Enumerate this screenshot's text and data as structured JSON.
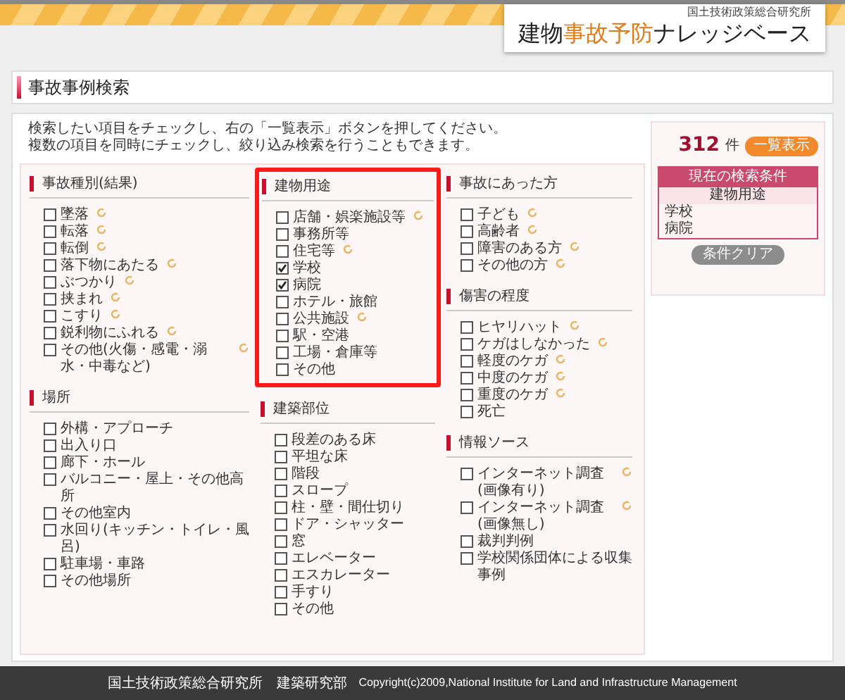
{
  "header": {
    "org": "国土技術政策総合研究所",
    "title_parts": [
      {
        "text": "建物",
        "accent": false
      },
      {
        "text": "事故予防",
        "accent": true
      },
      {
        "text": "ナレッジベース",
        "accent": false
      }
    ]
  },
  "page_title": "事故事例検索",
  "intro": [
    "検索したい項目をチェックし、右の「一覧表示」ボタンを押してください。",
    "複数の項目を同時にチェックし、絞り込み検索を行うこともできます。"
  ],
  "columns": [
    [
      {
        "heading": "事故種別(結果)",
        "highlighted": false,
        "items": [
          {
            "label": "墜落",
            "checked": false,
            "note": true
          },
          {
            "label": "転落",
            "checked": false,
            "note": true
          },
          {
            "label": "転倒",
            "checked": false,
            "note": true
          },
          {
            "label": "落下物にあたる",
            "checked": false,
            "note": true
          },
          {
            "label": "ぶつかり",
            "checked": false,
            "note": true
          },
          {
            "label": "挟まれ",
            "checked": false,
            "note": true
          },
          {
            "label": "こすり",
            "checked": false,
            "note": true
          },
          {
            "label": "鋭利物にふれる",
            "checked": false,
            "note": true
          },
          {
            "label": "その他(火傷・感電・溺水・中毒など)",
            "checked": false,
            "note": true
          }
        ]
      },
      {
        "heading": "場所",
        "highlighted": false,
        "items": [
          {
            "label": "外構・アプローチ",
            "checked": false,
            "note": false
          },
          {
            "label": "出入り口",
            "checked": false,
            "note": false
          },
          {
            "label": "廊下・ホール",
            "checked": false,
            "note": false
          },
          {
            "label": "バルコニー・屋上・その他高所",
            "checked": false,
            "note": false
          },
          {
            "label": "その他室内",
            "checked": false,
            "note": false
          },
          {
            "label": "水回り(キッチン・トイレ・風呂)",
            "checked": false,
            "note": false
          },
          {
            "label": "駐車場・車路",
            "checked": false,
            "note": false
          },
          {
            "label": "その他場所",
            "checked": false,
            "note": false
          }
        ]
      }
    ],
    [
      {
        "heading": "建物用途",
        "highlighted": true,
        "items": [
          {
            "label": "店舗・娯楽施設等",
            "checked": false,
            "note": true
          },
          {
            "label": "事務所等",
            "checked": false,
            "note": false
          },
          {
            "label": "住宅等",
            "checked": false,
            "note": true
          },
          {
            "label": "学校",
            "checked": true,
            "note": false
          },
          {
            "label": "病院",
            "checked": true,
            "note": false
          },
          {
            "label": "ホテル・旅館",
            "checked": false,
            "note": false
          },
          {
            "label": "公共施設",
            "checked": false,
            "note": true
          },
          {
            "label": "駅・空港",
            "checked": false,
            "note": false
          },
          {
            "label": "工場・倉庫等",
            "checked": false,
            "note": false
          },
          {
            "label": "その他",
            "checked": false,
            "note": false
          }
        ]
      },
      {
        "heading": "建築部位",
        "highlighted": false,
        "items": [
          {
            "label": "段差のある床",
            "checked": false,
            "note": false
          },
          {
            "label": "平坦な床",
            "checked": false,
            "note": false
          },
          {
            "label": "階段",
            "checked": false,
            "note": false
          },
          {
            "label": "スロープ",
            "checked": false,
            "note": false
          },
          {
            "label": "柱・壁・間仕切り",
            "checked": false,
            "note": false
          },
          {
            "label": "ドア・シャッター",
            "checked": false,
            "note": false
          },
          {
            "label": "窓",
            "checked": false,
            "note": false
          },
          {
            "label": "エレベーター",
            "checked": false,
            "note": false
          },
          {
            "label": "エスカレーター",
            "checked": false,
            "note": false
          },
          {
            "label": "手すり",
            "checked": false,
            "note": false
          },
          {
            "label": "その他",
            "checked": false,
            "note": false
          }
        ]
      }
    ],
    [
      {
        "heading": "事故にあった方",
        "highlighted": false,
        "items": [
          {
            "label": "子ども",
            "checked": false,
            "note": true
          },
          {
            "label": "高齢者",
            "checked": false,
            "note": true
          },
          {
            "label": "障害のある方",
            "checked": false,
            "note": true
          },
          {
            "label": "その他の方",
            "checked": false,
            "note": true
          }
        ]
      },
      {
        "heading": "傷害の程度",
        "highlighted": false,
        "items": [
          {
            "label": "ヒヤリハット",
            "checked": false,
            "note": true
          },
          {
            "label": "ケガはしなかった",
            "checked": false,
            "note": true
          },
          {
            "label": "軽度のケガ",
            "checked": false,
            "note": true
          },
          {
            "label": "中度のケガ",
            "checked": false,
            "note": true
          },
          {
            "label": "重度のケガ",
            "checked": false,
            "note": true
          },
          {
            "label": "死亡",
            "checked": false,
            "note": false
          }
        ]
      },
      {
        "heading": "情報ソース",
        "highlighted": false,
        "items": [
          {
            "label": "インターネット調査(画像有り)",
            "checked": false,
            "note": true
          },
          {
            "label": "インターネット調査(画像無し)",
            "checked": false,
            "note": true
          },
          {
            "label": "裁判判例",
            "checked": false,
            "note": false
          },
          {
            "label": "学校関係団体による収集事例",
            "checked": false,
            "note": false
          }
        ]
      }
    ]
  ],
  "result": {
    "count": "312",
    "unit": "件",
    "list_button": "一覧表示",
    "conditions_title": "現在の検索条件",
    "condition_group": "建物用途",
    "conditions": [
      "学校",
      "病院"
    ],
    "clear_button": "条件クリア"
  },
  "footer": {
    "org": "国土技術政策総合研究所　建築研究部",
    "copyright": "Copyright(c)2009,National Institute for Land and Infrastructure Management"
  }
}
